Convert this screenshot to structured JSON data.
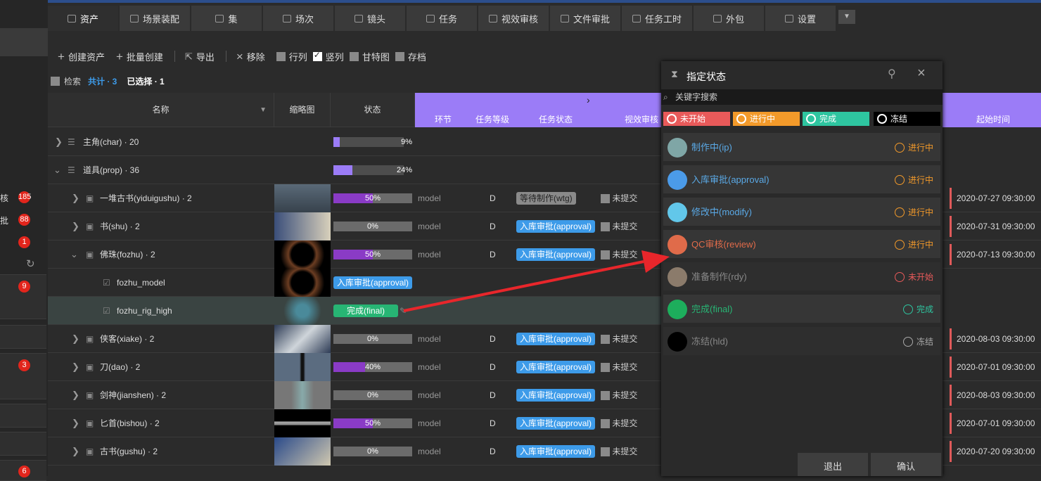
{
  "sidebar": {
    "labels": [
      "核",
      "批"
    ],
    "badges": [
      "185",
      "88",
      "1",
      "9",
      "3",
      "6"
    ]
  },
  "tabs": [
    {
      "label": "资产",
      "icon": "asset-icon",
      "active": true
    },
    {
      "label": "场景装配",
      "icon": "scene-icon"
    },
    {
      "label": "集",
      "icon": "episode-icon"
    },
    {
      "label": "场次",
      "icon": "sequence-icon"
    },
    {
      "label": "镜头",
      "icon": "shot-icon"
    },
    {
      "label": "任务",
      "icon": "task-icon"
    },
    {
      "label": "视效审核",
      "icon": "vfx-review-icon"
    },
    {
      "label": "文件审批",
      "icon": "file-approval-icon"
    },
    {
      "label": "任务工时",
      "icon": "timesheet-icon"
    },
    {
      "label": "外包",
      "icon": "outsource-icon"
    },
    {
      "label": "设置",
      "icon": "settings-icon"
    }
  ],
  "toolbar": {
    "create": "创建资产",
    "batch": "批量创建",
    "export": "导出",
    "remove": "移除",
    "row_view": "行列",
    "col_view": "竖列",
    "gantt": "甘特图",
    "archive": "存档"
  },
  "stats": {
    "search": "检索",
    "total": "共计 · 3",
    "selected": "已选择 · 1"
  },
  "columns": {
    "name": "名称",
    "thumb": "缩略图",
    "status": "状态",
    "stage": "环节",
    "level": "任务等级",
    "task_status": "任务状态",
    "vfx": "视效审核",
    "start": "起始时间"
  },
  "rows": [
    {
      "name": "主角(char) · 20",
      "progress": "9%",
      "pct": 9,
      "group": true,
      "expanded": false
    },
    {
      "name": "道具(prop) · 36",
      "progress": "24%",
      "pct": 24,
      "group": true,
      "expanded": true
    },
    {
      "name": "一堆古书(yiduigushu) · 2",
      "progress": "50%",
      "pct": 50,
      "stage": "model",
      "level": "D",
      "task": "等待制作(wtg)",
      "task_color": "grey",
      "sub": "未提交",
      "start": "2020-07-27 09:30:00"
    },
    {
      "name": "书(shu) · 2",
      "progress": "0%",
      "pct": 0,
      "stage": "model",
      "level": "D",
      "task": "入库审批(approval)",
      "sub": "未提交",
      "start": "2020-07-31 09:30:00"
    },
    {
      "name": "佛珠(fozhu) · 2",
      "progress": "50%",
      "pct": 50,
      "stage": "model",
      "level": "D",
      "task": "入库审批(approval)",
      "sub": "未提交",
      "start": "2020-07-13 09:30:00",
      "expanded": true
    },
    {
      "name": "fozhu_model",
      "status_badge": "入库审批(approval)",
      "child": true
    },
    {
      "name": "fozhu_rig_high",
      "status_badge": "完成(final)",
      "child": true,
      "selected": true
    },
    {
      "name": "侠客(xiake) · 2",
      "progress": "0%",
      "pct": 0,
      "stage": "model",
      "level": "D",
      "task": "入库审批(approval)",
      "sub": "未提交",
      "start": "2020-08-03 09:30:00"
    },
    {
      "name": "刀(dao) · 2",
      "progress": "40%",
      "pct": 40,
      "stage": "model",
      "level": "D",
      "task": "入库审批(approval)",
      "sub": "未提交",
      "start": "2020-07-01 09:30:00"
    },
    {
      "name": "剑神(jianshen) · 2",
      "progress": "0%",
      "pct": 0,
      "stage": "model",
      "level": "D",
      "task": "入库审批(approval)",
      "sub": "未提交",
      "start": "2020-08-03 09:30:00"
    },
    {
      "name": "匕首(bishou) · 2",
      "progress": "50%",
      "pct": 50,
      "stage": "model",
      "level": "D",
      "task": "入库审批(approval)",
      "sub": "未提交",
      "start": "2020-07-01 09:30:00"
    },
    {
      "name": "古书(gushu) · 2",
      "progress": "0%",
      "pct": 0,
      "stage": "model",
      "level": "D",
      "task": "入库审批(approval)",
      "sub": "未提交",
      "start": "2020-07-20 09:30:00"
    }
  ],
  "dialog": {
    "title": "指定状态",
    "search_placeholder": "关键字搜索",
    "filters": [
      {
        "label": "未开始",
        "color": "#e85a5a"
      },
      {
        "label": "进行中",
        "color": "#f39a2a"
      },
      {
        "label": "完成",
        "color": "#2ec5a0"
      },
      {
        "label": "冻结",
        "color": "#000000"
      }
    ],
    "items": [
      {
        "name": "制作中(ip)",
        "dot": "#7fa6a6",
        "name_color": "#5aa9e6",
        "state": "进行中",
        "state_color": "#f39a2a"
      },
      {
        "name": "入库审批(approval)",
        "dot": "#4b9be9",
        "name_color": "#5aa9e6",
        "state": "进行中",
        "state_color": "#f39a2a"
      },
      {
        "name": "修改中(modify)",
        "dot": "#62c7ea",
        "name_color": "#5aa9e6",
        "state": "进行中",
        "state_color": "#f39a2a"
      },
      {
        "name": "QC审核(review)",
        "dot": "#e06b4a",
        "name_color": "#e06b4a",
        "state": "进行中",
        "state_color": "#f39a2a"
      },
      {
        "name": "准备制作(rdy)",
        "dot": "#8b7b6b",
        "name_color": "#888888",
        "state": "未开始",
        "state_color": "#e85a5a"
      },
      {
        "name": "完成(final)",
        "dot": "#1dae5c",
        "name_color": "#27b574",
        "state": "完成",
        "state_color": "#2ec5a0"
      },
      {
        "name": "冻结(hld)",
        "dot": "#000000",
        "name_color": "#888888",
        "state": "冻结",
        "state_color": "#aaaaaa"
      }
    ],
    "cancel": "退出",
    "confirm": "确认"
  }
}
